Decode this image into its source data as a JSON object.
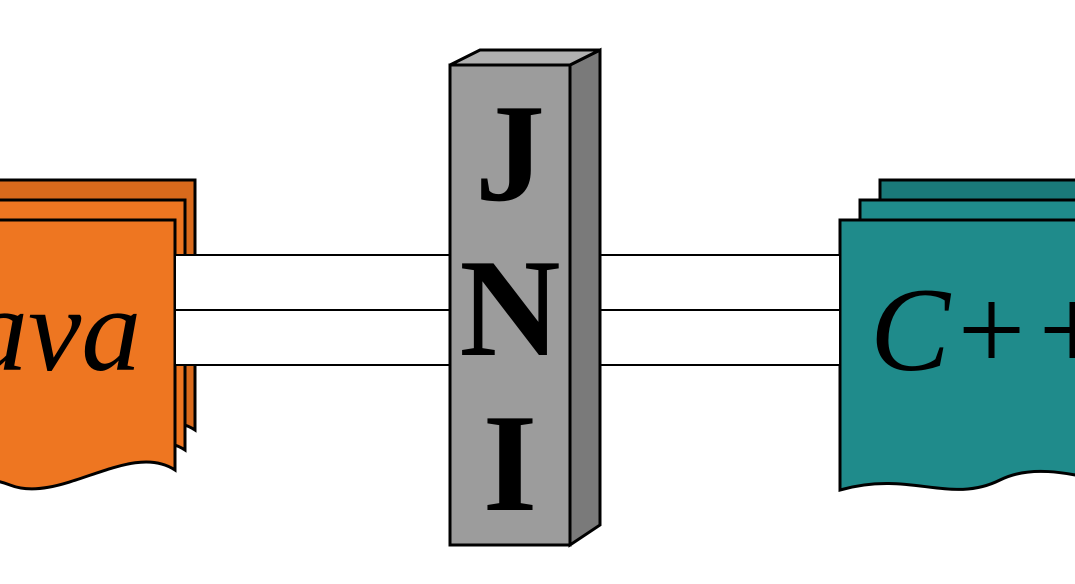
{
  "diagram": {
    "left_block": {
      "label": "Java",
      "visible_text": "ava",
      "color": "#ee7621",
      "color_dark": "#d96a1c"
    },
    "right_block": {
      "label": "C++",
      "visible_text": "C++",
      "color": "#1f8b8b",
      "color_dark": "#1a7a7a"
    },
    "center_pillar": {
      "label": "JNI",
      "letters": [
        "J",
        "N",
        "I"
      ],
      "face_color": "#9c9c9c",
      "side_color": "#7a7a7a",
      "top_color": "#b0b0b0"
    },
    "connector_color": "#000000"
  }
}
